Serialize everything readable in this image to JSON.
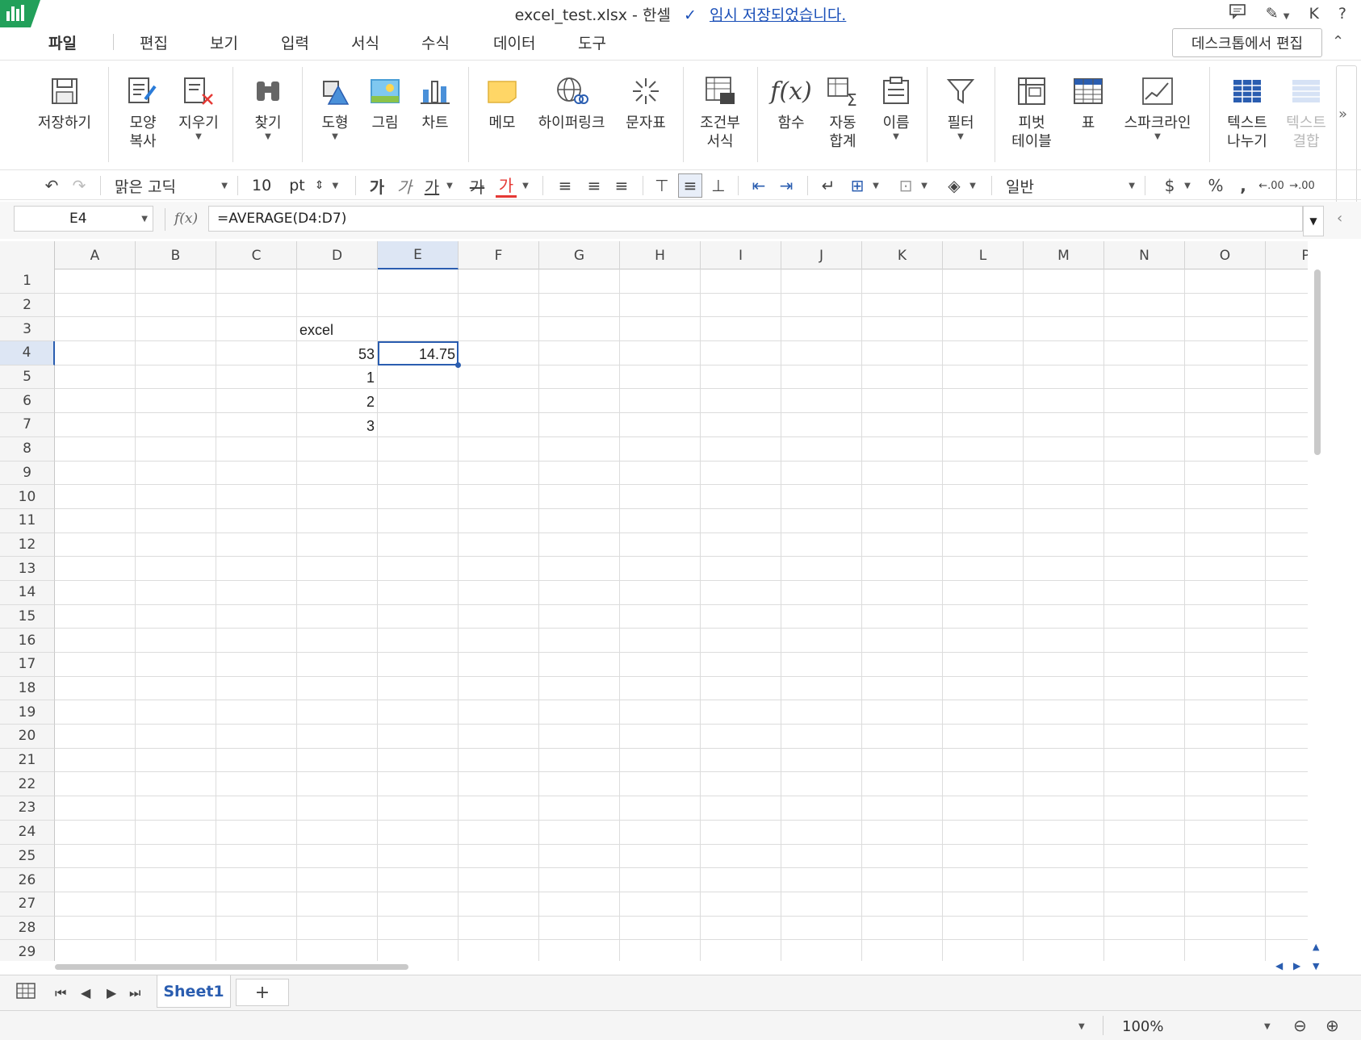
{
  "titlebar": {
    "filename": "excel_test.xlsx - 한셀",
    "save_status": "임시 저장되었습니다.",
    "user_initial": "K",
    "help": "?"
  },
  "menu": {
    "items": [
      "파일",
      "편집",
      "보기",
      "입력",
      "서식",
      "수식",
      "데이터",
      "도구"
    ],
    "active": "파일",
    "desktop_edit": "데스크톱에서 편집"
  },
  "ribbon": {
    "save": "저장하기",
    "format_copy": "모양\n복사",
    "clear": "지우기",
    "find": "찾기",
    "shape": "도형",
    "picture": "그림",
    "chart": "차트",
    "memo": "메모",
    "hyperlink": "하이퍼링크",
    "symbol": "문자표",
    "conditional_format": "조건부\n서식",
    "function": "함수",
    "autosum": "자동\n합계",
    "name": "이름",
    "filter": "필터",
    "pivot": "피벗\n테이블",
    "table": "표",
    "sparkline": "스파크라인",
    "text_split": "텍스트\n나누기",
    "text_join": "텍스트\n결합"
  },
  "format": {
    "font": "맑은 고딕",
    "size": "10",
    "size_unit": "pt",
    "bold": "가",
    "italic": "가",
    "underline": "가",
    "strike": "가",
    "color": "가",
    "number_format": "일반",
    "currency": "$",
    "percent": "%",
    "comma": ",",
    "dec_inc": ".00",
    "dec_dec": ".00"
  },
  "formula": {
    "cell_ref": "E4",
    "fx": "f(x)",
    "value": "=AVERAGE(D4:D7)"
  },
  "grid": {
    "columns": [
      "A",
      "B",
      "C",
      "D",
      "E",
      "F",
      "G",
      "H",
      "I",
      "J",
      "K",
      "L",
      "M",
      "N",
      "O",
      "P"
    ],
    "rows": [
      "1",
      "2",
      "3",
      "4",
      "5",
      "6",
      "7",
      "8",
      "9",
      "10",
      "11",
      "12",
      "13",
      "14",
      "15",
      "16",
      "17",
      "18",
      "19",
      "20",
      "21",
      "22",
      "23",
      "24",
      "25",
      "26",
      "27",
      "28",
      "29"
    ],
    "selected_col": "E",
    "selected_row": "4",
    "cells": [
      {
        "ref": "D3",
        "value": "excel",
        "type": "text"
      },
      {
        "ref": "D4",
        "value": "53",
        "type": "num"
      },
      {
        "ref": "E4",
        "value": "14.75",
        "type": "num"
      },
      {
        "ref": "D5",
        "value": "1",
        "type": "num"
      },
      {
        "ref": "D6",
        "value": "2",
        "type": "num"
      },
      {
        "ref": "D7",
        "value": "3",
        "type": "num"
      }
    ]
  },
  "sheets": {
    "tabs": [
      "Sheet1"
    ],
    "add": "+"
  },
  "status": {
    "zoom": "100%"
  },
  "colors": {
    "accent": "#2a5db0",
    "logo": "#22a05a"
  }
}
